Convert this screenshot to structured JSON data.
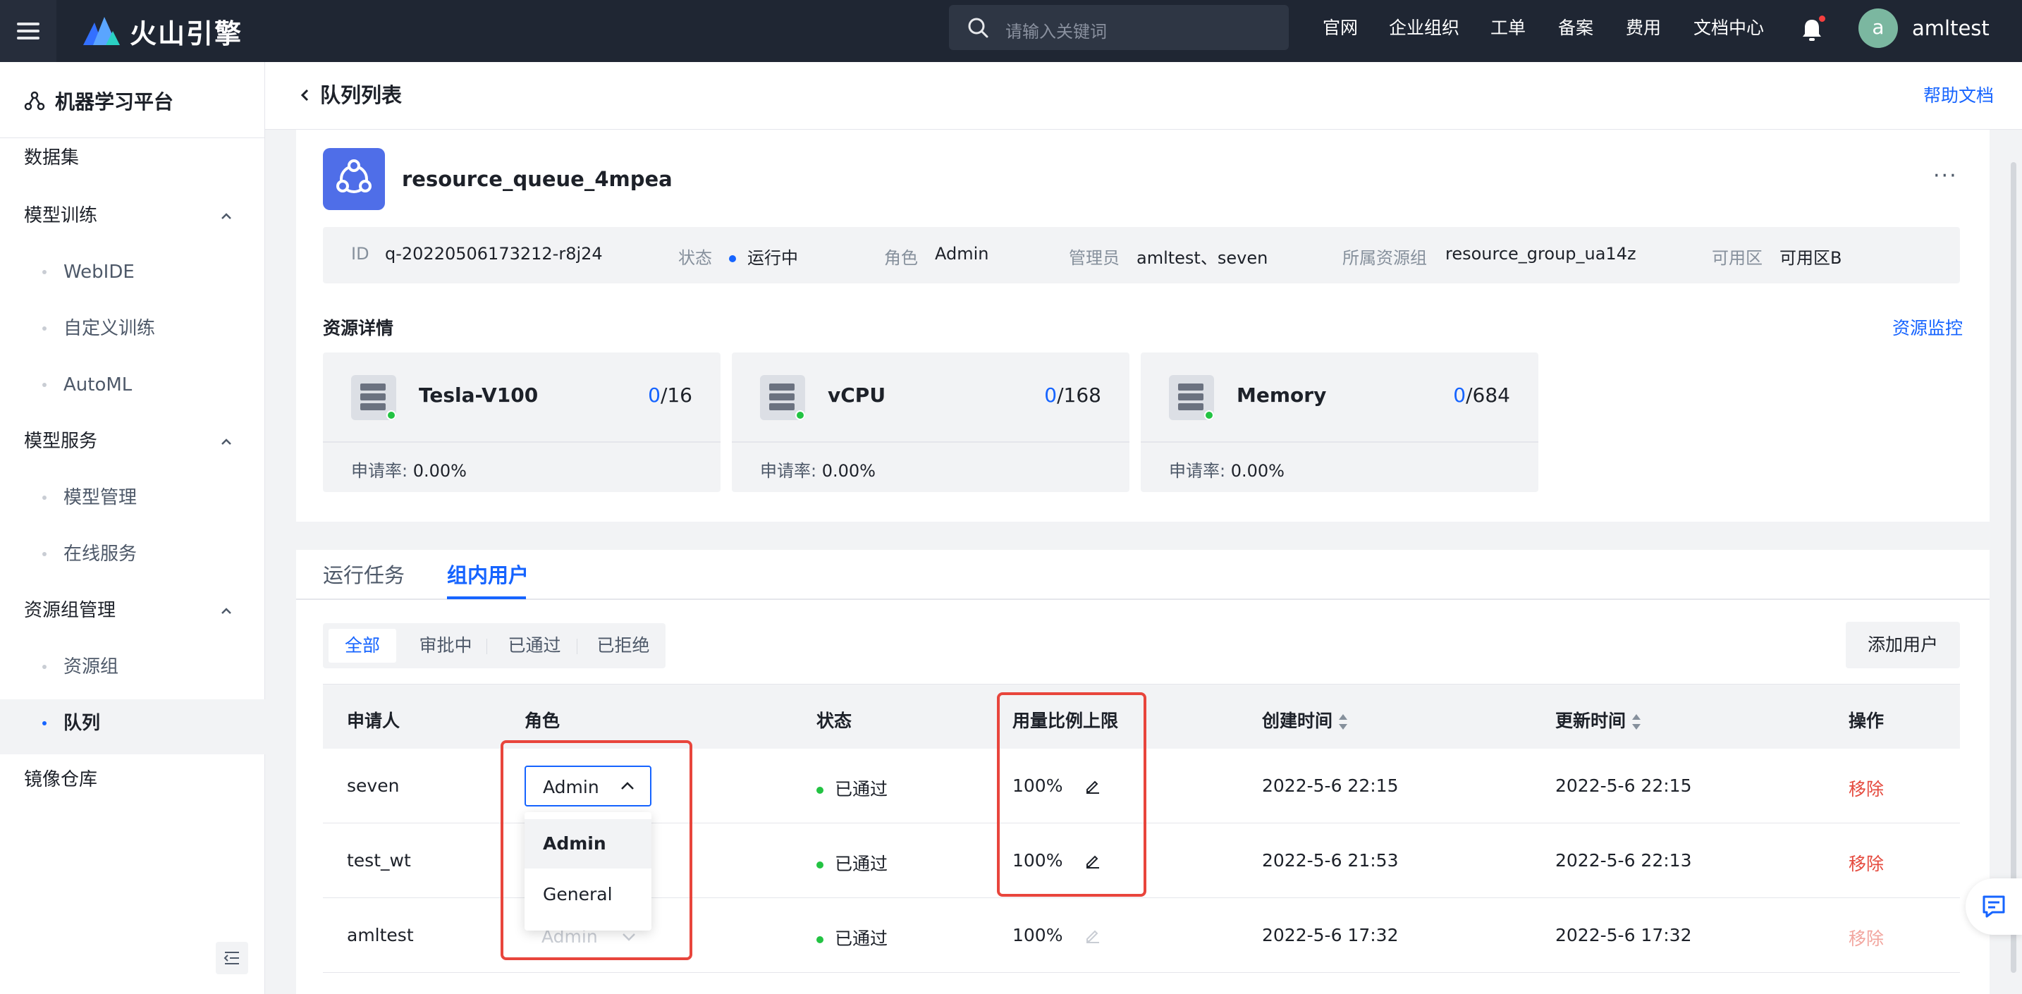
{
  "topbar": {
    "brand": "火山引擎",
    "search_placeholder": "请输入关键词",
    "nav": [
      "官网",
      "企业组织",
      "工单",
      "备案",
      "费用",
      "文档中心"
    ],
    "avatar_letter": "a",
    "username": "amltest"
  },
  "sidebar": {
    "title": "机器学习平台",
    "items": {
      "dataset": "数据集",
      "training": "模型训练",
      "webide": "WebIDE",
      "custom_training": "自定义训练",
      "automl": "AutoML",
      "model_service": "模型服务",
      "model_management": "模型管理",
      "online_service": "在线服务",
      "resource_group_mgmt": "资源组管理",
      "resource_group": "资源组",
      "queue": "队列",
      "image_repo": "镜像仓库"
    }
  },
  "header": {
    "title": "队列列表",
    "help": "帮助文档"
  },
  "queue": {
    "name": "resource_queue_4mpea",
    "more": "···",
    "info": {
      "id_label": "ID",
      "id_value": "q-20220506173212-r8j24",
      "status_label": "状态",
      "status_value": "运行中",
      "role_label": "角色",
      "role_value": "Admin",
      "admin_label": "管理员",
      "admin_value": "amltest、seven",
      "group_label": "所属资源组",
      "group_value": "resource_group_ua14z",
      "zone_label": "可用区",
      "zone_value": "可用区B"
    },
    "resource_title": "资源详情",
    "monitor_link": "资源监控",
    "resources": [
      {
        "name": "Tesla-V100",
        "used": "0",
        "total": "/16",
        "rate_label": "申请率:",
        "rate": "0.00%"
      },
      {
        "name": "vCPU",
        "used": "0",
        "total": "/168",
        "rate_label": "申请率:",
        "rate": "0.00%"
      },
      {
        "name": "Memory",
        "used": "0",
        "total": "/684",
        "rate_label": "申请率:",
        "rate": "0.00%"
      }
    ]
  },
  "tabs": {
    "running": "运行任务",
    "users": "组内用户"
  },
  "filters": [
    "全部",
    "审批中",
    "已通过",
    "已拒绝"
  ],
  "add_user": "添加用户",
  "table": {
    "headers": {
      "applicant": "申请人",
      "role": "角色",
      "status": "状态",
      "quota": "用量比例上限",
      "created": "创建时间",
      "updated": "更新时间",
      "action": "操作"
    },
    "rows": [
      {
        "applicant": "seven",
        "role": "Admin",
        "status": "已通过",
        "quota": "100%",
        "created": "2022-5-6 22:15",
        "updated": "2022-5-6 22:15",
        "action": "移除"
      },
      {
        "applicant": "test_wt",
        "role": "",
        "status": "已通过",
        "quota": "100%",
        "created": "2022-5-6 21:53",
        "updated": "2022-5-6 22:13",
        "action": "移除"
      },
      {
        "applicant": "amltest",
        "role": "Admin",
        "status": "已通过",
        "quota": "100%",
        "created": "2022-5-6 17:32",
        "updated": "2022-5-6 17:32",
        "action": "移除"
      }
    ],
    "dropdown_options": [
      "Admin",
      "General"
    ]
  },
  "colors": {
    "topbar": "#1f2633",
    "accent": "#1664ff",
    "success": "#23c343",
    "danger": "#e54a3e",
    "highlight": "#e8453c"
  }
}
